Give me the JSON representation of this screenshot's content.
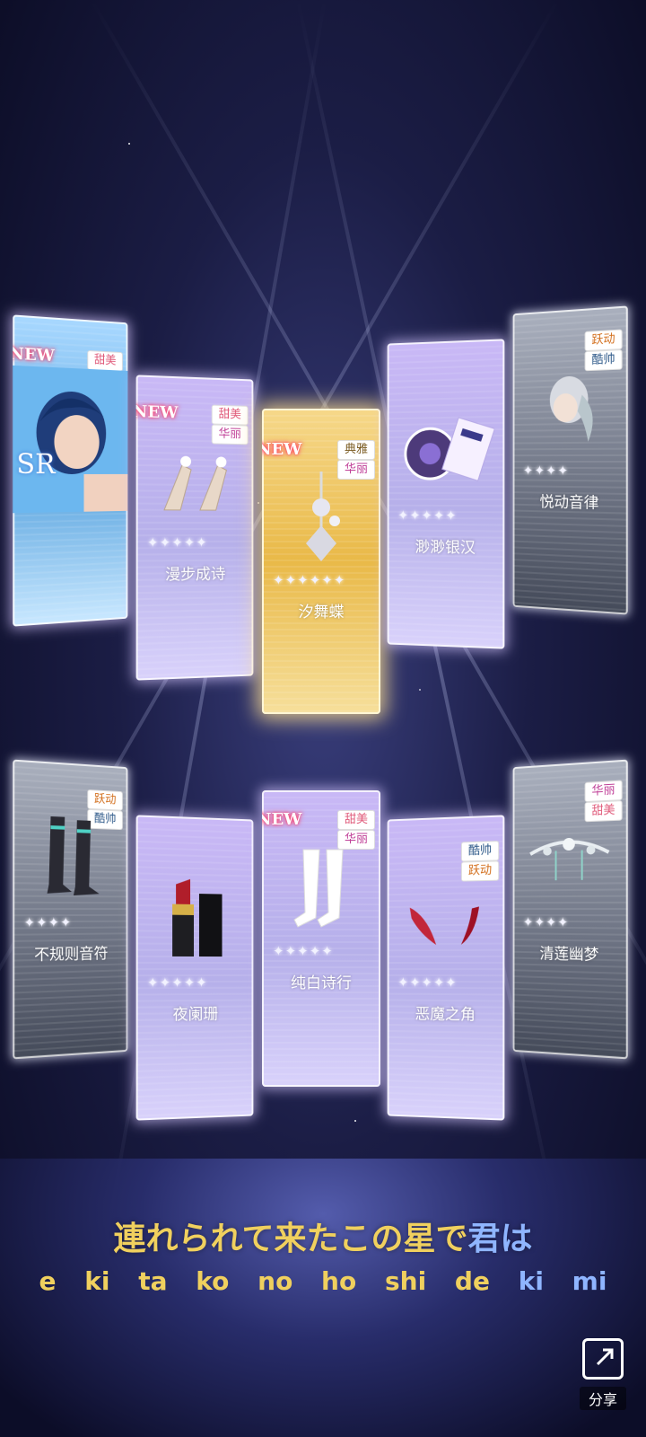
{
  "scene": {
    "title": ""
  },
  "cards_top": [
    {
      "new_badge": "NEW",
      "tags": [
        "甜美"
      ],
      "type": "sr",
      "rarity": "SR",
      "stars": "",
      "name": ""
    },
    {
      "new_badge": "NEW",
      "tags": [
        "甜美",
        "华丽"
      ],
      "type": "purple",
      "stars": "✦✦✦✦✦",
      "name": "漫步成诗"
    },
    {
      "new_badge": "NEW",
      "tags": [
        "典雅",
        "华丽"
      ],
      "type": "gold",
      "stars": "✦✦✦✦✦✦",
      "name": "汐舞蝶"
    },
    {
      "new_badge": "",
      "tags": [],
      "type": "purple",
      "stars": "✦✦✦✦✦",
      "name": "渺渺银汉"
    },
    {
      "new_badge": "",
      "tags": [
        "跃动",
        "酷帅"
      ],
      "type": "grey",
      "stars": "✦✦✦✦",
      "name": "悦动音律"
    }
  ],
  "cards_bottom": [
    {
      "new_badge": "",
      "tags": [
        "跃动",
        "酷帅"
      ],
      "type": "grey",
      "stars": "✦✦✦✦",
      "name": "不规则音符"
    },
    {
      "new_badge": "",
      "tags": [],
      "type": "purple",
      "stars": "✦✦✦✦✦",
      "name": "夜阑珊"
    },
    {
      "new_badge": "NEW",
      "tags": [
        "甜美",
        "华丽"
      ],
      "type": "purple",
      "stars": "✦✦✦✦✦",
      "name": "纯白诗行"
    },
    {
      "new_badge": "",
      "tags": [
        "酷帅",
        "跃动"
      ],
      "type": "purple",
      "stars": "✦✦✦✦✦",
      "name": "恶魔之角"
    },
    {
      "new_badge": "",
      "tags": [
        "华丽",
        "甜美"
      ],
      "type": "grey",
      "stars": "✦✦✦✦",
      "name": "清莲幽梦"
    }
  ],
  "lyrics": {
    "line_main_highlight": "連れられて来たこの星で",
    "line_main_rest": "君は",
    "romaji_highlight": "e ki ta ko no ho shi de",
    "romaji_rest": "ki mi"
  },
  "share": {
    "label": "分享",
    "icon": "share-icon"
  }
}
